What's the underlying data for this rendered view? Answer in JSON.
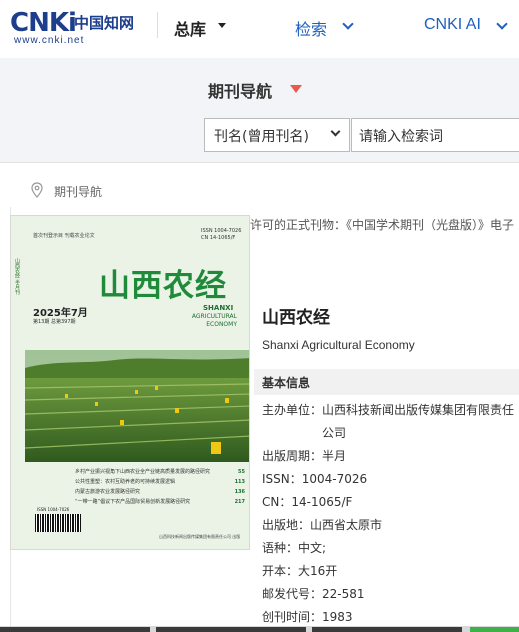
{
  "header": {
    "logo_mark": "CNKi",
    "logo_cn": "中国知网",
    "logo_url": "www.cnki.net",
    "nav_zongku": "总库",
    "nav_search": "检索",
    "nav_ai": "CNKI AI"
  },
  "subnav": {
    "title": "期刊导航",
    "select_value": "刊名(曾用刊名)",
    "search_placeholder": "请输入检索词"
  },
  "breadcrumb": {
    "label": "期刊导航"
  },
  "notice": "许可的正式刊物：《中国学术期刊（光盘版）》电子",
  "cover": {
    "top_text": "首次刊登示目    刊载农业论文",
    "issn": "ISSN 1004-7026",
    "cn": "CN 14-1065/F",
    "side_text": "山西农经 半月刊",
    "title": "山西农经",
    "date": "2025年7月",
    "volume": "第13期 总第397期",
    "en_1": "SHANXI",
    "en_2": "AGRICULTURAL ECONOMY",
    "lines": [
      {
        "text": "乡村产业振兴视角下山西农业全产业链高质量发展的路径研究",
        "page": "55"
      },
      {
        "text": "公共性重塑：农村互助养老的可持续发展逻辑",
        "page": "113"
      },
      {
        "text": "内蒙古旅游农业发展路径研究",
        "page": "136"
      },
      {
        "text": "“一带一路”倡议下农产品国际贸易创新发展路径研究",
        "page": "217"
      }
    ],
    "barcode_text": "ISSN 1004-7026",
    "publisher": "山西科技新闻出版传媒集团有限责任公司 出版"
  },
  "journal": {
    "title": "山西农经",
    "english": "Shanxi Agricultural Economy",
    "section": "基本信息",
    "fields": [
      {
        "label": "主办单位：",
        "value": "山西科技新闻出版传媒集团有限责任"
      },
      {
        "label": "",
        "value": "公司"
      },
      {
        "label": "出版周期：",
        "value": "半月"
      },
      {
        "label": "ISSN：",
        "value": "1004-7026"
      },
      {
        "label": "CN：",
        "value": "14-1065/F"
      },
      {
        "label": "出版地：",
        "value": "山西省太原市"
      },
      {
        "label": "语种：",
        "value": "中文;"
      },
      {
        "label": "开本：",
        "value": "大16开"
      },
      {
        "label": "邮发代号：",
        "value": "22-581"
      },
      {
        "label": "创刊时间：",
        "value": "1983"
      }
    ]
  },
  "colors": {
    "brand": "#1d3e8c",
    "link": "#1f5fbf",
    "accent_caret": "#e85a4f",
    "cover_title": "#1e8a3a"
  }
}
